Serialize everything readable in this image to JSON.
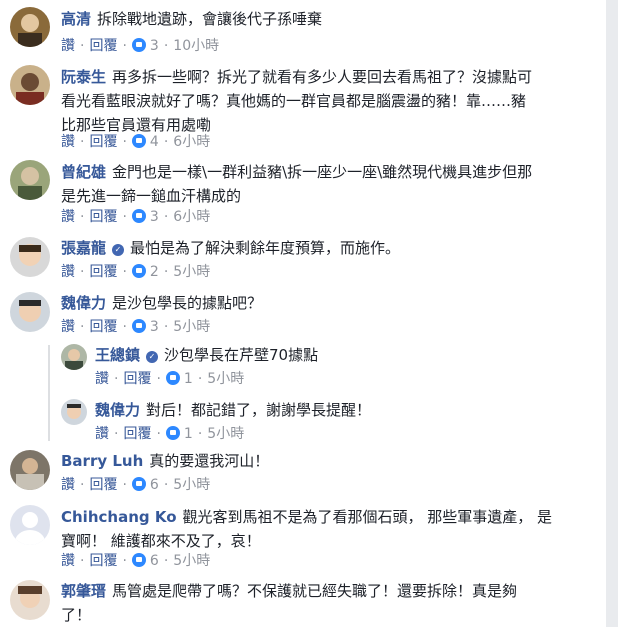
{
  "actions": {
    "like": "讚",
    "reply": "回覆",
    "sep": "·"
  },
  "comments": [
    {
      "name": "高清",
      "text": [
        "拆除戰地遺跡，會讓後代子孫唾棄"
      ],
      "likes": "3",
      "time": "10小時",
      "verified": false
    },
    {
      "name": "阮泰生",
      "text": [
        "再多拆一些啊？拆光了就看有多少人要回去看馬祖了？沒據點可",
        "看光看藍眼淚就好了嗎？真他媽的一群官員都是腦震盪的豬！靠……豬",
        "比那些官員還有用處嘞"
      ],
      "likes": "4",
      "time": "6小時",
      "verified": false
    },
    {
      "name": "曾紀雄",
      "text": [
        "金門也是一樣\\一群利益豬\\拆一座少一座\\雖然現代機具進步但那",
        "是先進一鍗一鎚血汗構成的"
      ],
      "likes": "3",
      "time": "6小時",
      "verified": false
    },
    {
      "name": "張嘉龍",
      "text": [
        "最怕是為了解決剩餘年度預算，而施作。"
      ],
      "likes": "2",
      "time": "5小時",
      "verified": true
    },
    {
      "name": "魏偉力",
      "text": [
        "是沙包學長的據點吧？"
      ],
      "likes": "3",
      "time": "5小時",
      "verified": false
    },
    {
      "name": "王總鎮",
      "text": [
        "沙包學長在芹壁70據點"
      ],
      "likes": "1",
      "time": "5小時",
      "verified": true
    },
    {
      "name": "魏偉力",
      "text": [
        "對后！都記錯了，謝謝學長提醒！"
      ],
      "likes": "1",
      "time": "5小時",
      "verified": false
    },
    {
      "name": "Barry Luh",
      "text": [
        "真的要還我河山！"
      ],
      "likes": "6",
      "time": "5小時",
      "verified": false
    },
    {
      "name": "Chihchang Ko",
      "text": [
        "觀光客到馬祖不是為了看那個石頭， 那些軍事遺產， 是",
        "寶啊！ 維護都來不及了，哀！"
      ],
      "likes": "6",
      "time": "5小時",
      "verified": false
    },
    {
      "name": "郭肇瑨",
      "text": [
        "馬管處是爬帶了嗎？不保護就已經失職了！還要拆除！真是夠",
        "了！"
      ],
      "likes": "",
      "time": "",
      "verified": false
    }
  ],
  "colors": {
    "link": "#365899",
    "muted": "#90949c",
    "like_blue": "#2d88ff"
  }
}
